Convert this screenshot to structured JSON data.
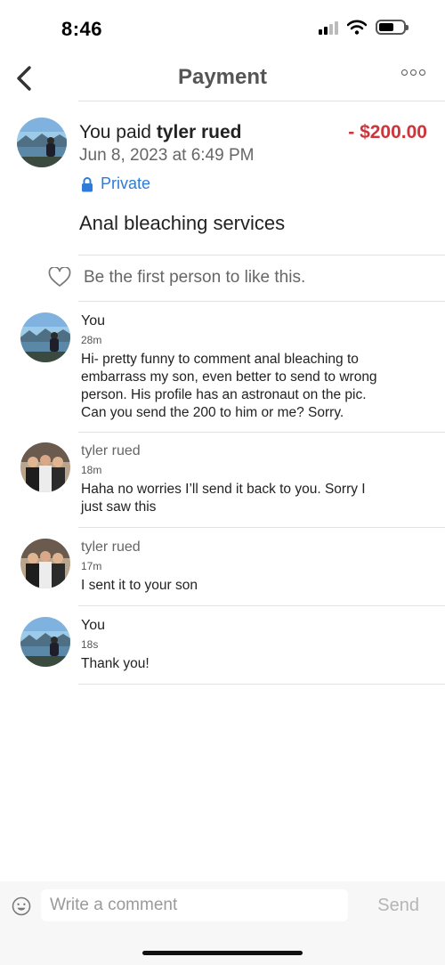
{
  "status_bar": {
    "time": "8:46"
  },
  "nav": {
    "title": "Payment"
  },
  "payment": {
    "summary_prefix": "You paid ",
    "payee": "tyler rued",
    "amount": "- $200.00",
    "date": "Jun 8, 2023 at 6:49 PM",
    "privacy": "Private",
    "note": "Anal bleaching services",
    "like_prompt": "Be the first person to like this."
  },
  "comments": [
    {
      "author": "You",
      "time": "28m",
      "lines": [
        "Hi- pretty funny to comment anal bleaching to",
        "embarrass my son, even better to send to wrong",
        "person.  His profile has an astronaut on the pic.",
        "Can you send  the 200 to him or me?  Sorry."
      ]
    },
    {
      "author": "tyler rued",
      "time": "18m",
      "lines": [
        "Haha no worries I’ll send it back to you. Sorry I",
        "just saw this"
      ]
    },
    {
      "author": "tyler rued",
      "time": "17m",
      "lines": [
        "I sent it to your son"
      ]
    },
    {
      "author": "You",
      "time": "18s",
      "lines": [
        "Thank you!"
      ]
    }
  ],
  "composer": {
    "placeholder": "Write a comment",
    "send_label": "Send"
  },
  "colors": {
    "amount": "#d0333a",
    "link": "#2f7bd7",
    "muted": "#666666"
  }
}
